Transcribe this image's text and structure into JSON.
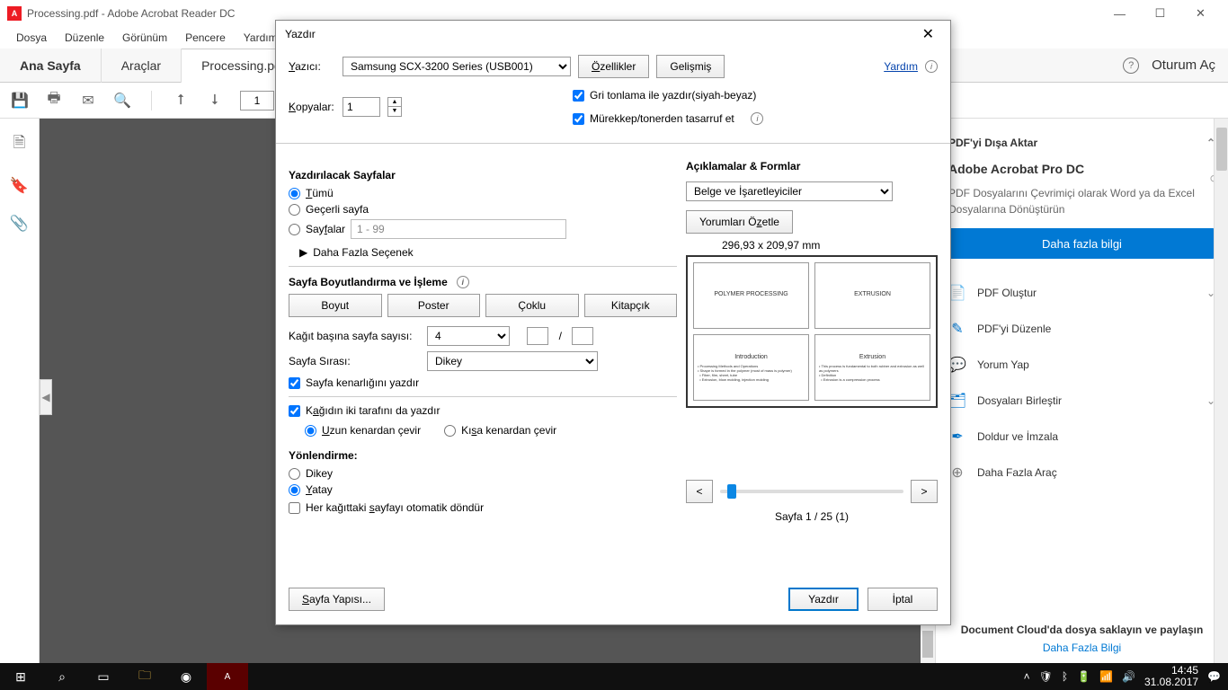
{
  "titlebar": {
    "title": "Processing.pdf - Adobe Acrobat Reader DC"
  },
  "menubar": [
    "Dosya",
    "Düzenle",
    "Görünüm",
    "Pencere",
    "Yardım"
  ],
  "tabs": {
    "home": "Ana Sayfa",
    "tools": "Araçlar",
    "doc": "Processing.pdf"
  },
  "toolbar_right": {
    "login": "Oturum Aç"
  },
  "page_input": "1",
  "right_panel": {
    "export_head": "PDF'yi Dışa Aktar",
    "pro_title": "Adobe Acrobat Pro DC",
    "pro_desc": "PDF Dosyalarını Çevrimiçi olarak Word ya da Excel Dosyalarına Dönüştürün",
    "more_btn": "Daha fazla bilgi",
    "items": [
      {
        "label": "PDF Oluştur",
        "icon": "📄",
        "chev": true
      },
      {
        "label": "PDF'yi Düzenle",
        "icon": "✎"
      },
      {
        "label": "Yorum Yap",
        "icon": "💬"
      },
      {
        "label": "Dosyaları Birleştir",
        "icon": "🗂",
        "chev": true
      },
      {
        "label": "Doldur ve İmzala",
        "icon": "✒"
      },
      {
        "label": "Daha Fazla Araç",
        "icon": "⊕"
      }
    ],
    "foot_msg": "Document Cloud'da dosya saklayın ve paylaşın",
    "foot_link": "Daha Fazla Bilgi"
  },
  "dialog": {
    "title": "Yazdır",
    "printer_label": "Yazıcı:",
    "printer": "Samsung SCX-3200 Series (USB001)",
    "props_btn": "Özellikler",
    "adv_btn": "Gelişmiş",
    "help": "Yardım",
    "copies_label": "Kopyalar:",
    "copies": "1",
    "grayscale": "Gri tonlama ile yazdır(siyah-beyaz)",
    "save_ink": "Mürekkep/tonerden tasarruf et",
    "pages_section": "Yazdırılacak Sayfalar",
    "all": "Tümü",
    "current": "Geçerli sayfa",
    "pages_label": "Sayfalar",
    "pages_range": "1 - 99",
    "more_options": "Daha Fazla Seçenek",
    "sizing_section": "Sayfa Boyutlandırma ve İşleme",
    "seg": [
      "Boyut",
      "Poster",
      "Çoklu",
      "Kitapçık"
    ],
    "per_sheet_label": "Kağıt başına sayfa sayısı:",
    "per_sheet": "4",
    "order_label": "Sayfa Sırası:",
    "order": "Dikey",
    "border": "Sayfa kenarlığını yazdır",
    "duplex": "Kağıdın iki tarafını da yazdır",
    "flip_long": "Uzun kenardan çevir",
    "flip_short": "Kısa kenardan çevir",
    "orient_section": "Yönlendirme:",
    "portrait": "Dikey",
    "landscape": "Yatay",
    "auto_rotate": "Her kağıttaki sayfayı otomatik döndür",
    "comments_section": "Açıklamalar & Formlar",
    "comments_select": "Belge ve İşaretleyiciler",
    "summarize": "Yorumları Özetle",
    "preview_dim": "296,93 x 209,97 mm",
    "pv": [
      [
        "POLYMER PROCESSING"
      ],
      [
        "EXTRUSION"
      ],
      [
        "Introduction"
      ],
      [
        "Extrusion"
      ]
    ],
    "page_counter": "Sayfa 1 / 25 (1)",
    "page_setup": "Sayfa Yapısı...",
    "print": "Yazdır",
    "cancel": "İptal"
  },
  "taskbar": {
    "time": "14:45",
    "date": "31.08.2017"
  }
}
